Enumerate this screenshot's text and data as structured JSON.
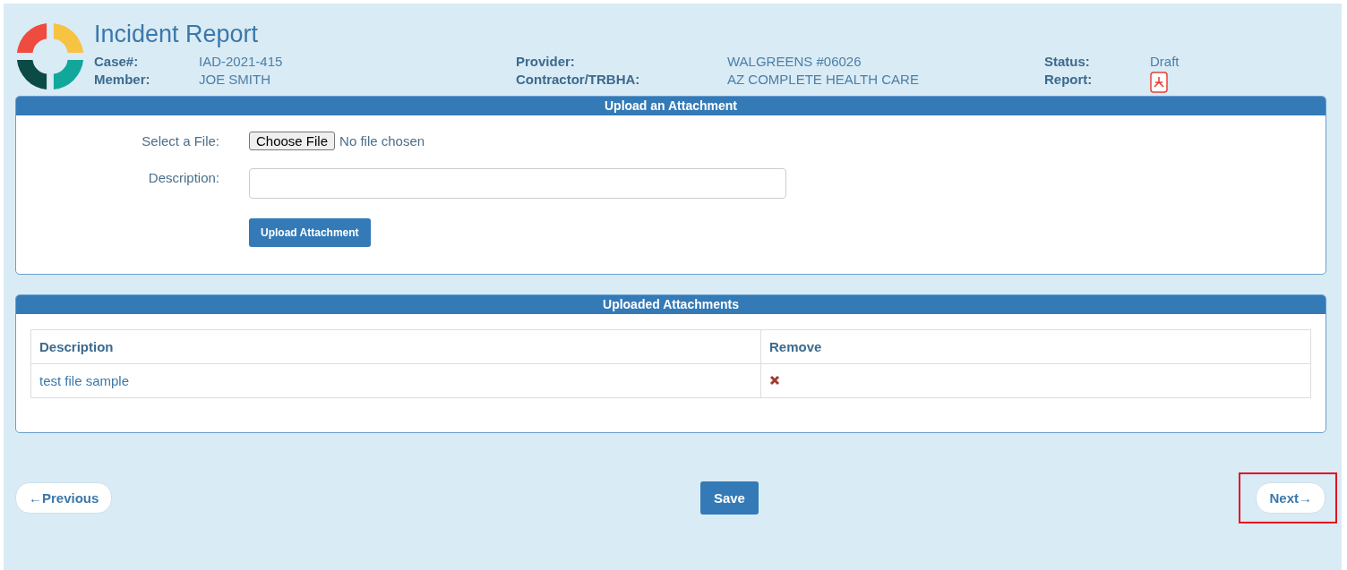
{
  "header": {
    "title": "Incident Report",
    "fields": [
      {
        "label": "Case#:",
        "value": "IAD-2021-415"
      },
      {
        "label": "Member:",
        "value": "JOE SMITH"
      },
      {
        "label": "Provider:",
        "value": "WALGREENS #06026"
      },
      {
        "label": "Contractor/TRBHA:",
        "value": "AZ COMPLETE HEALTH CARE"
      },
      {
        "label": "Status:",
        "value": "Draft"
      },
      {
        "label": "Report:",
        "kind": "pdf"
      }
    ]
  },
  "upload_panel": {
    "title": "Upload an Attachment",
    "file_label": "Select a File:",
    "choose_button": "Choose File",
    "file_status": "No file chosen",
    "description_label": "Description:",
    "upload_button": "Upload Attachment"
  },
  "attachments_panel": {
    "title": "Uploaded Attachments",
    "columns": [
      "Description",
      "Remove"
    ],
    "rows": [
      {
        "description": "test file sample"
      }
    ]
  },
  "footer": {
    "previous": "←Previous",
    "save": "Save",
    "next": "Next→",
    "highlight_next": true
  }
}
